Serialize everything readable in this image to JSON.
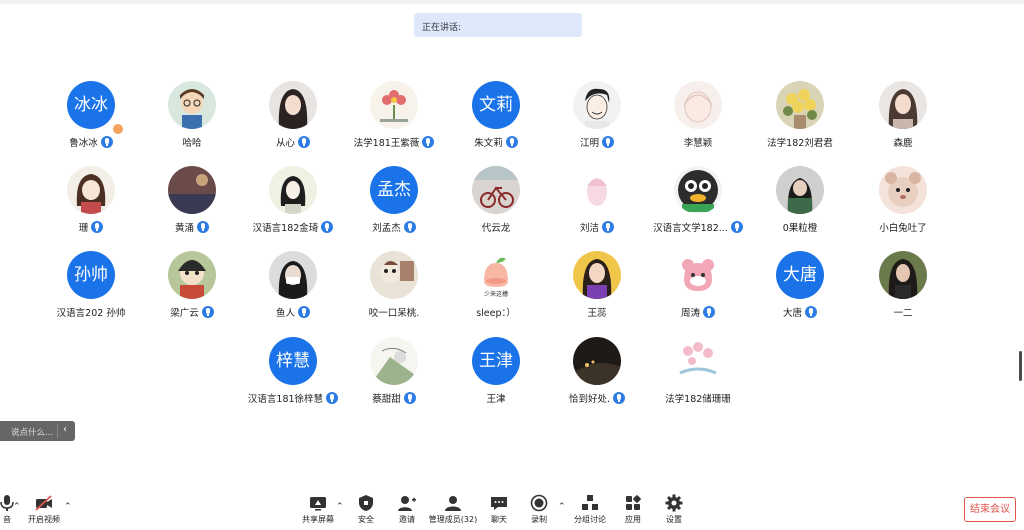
{
  "speaking_banner": "正在讲话:",
  "participants": [
    {
      "name": "鲁冰冰",
      "avatar_text": "冰冰",
      "mic": true,
      "host": true
    },
    {
      "name": "哈哈",
      "avatar_text": "",
      "mic": false
    },
    {
      "name": "从心",
      "avatar_text": "",
      "mic": true
    },
    {
      "name": "法学181王紫薇",
      "avatar_text": "",
      "mic": true
    },
    {
      "name": "朱文莉",
      "avatar_text": "文莉",
      "mic": true
    },
    {
      "name": "江明",
      "avatar_text": "",
      "mic": true
    },
    {
      "name": "李慧颖",
      "avatar_text": "",
      "mic": false
    },
    {
      "name": "法学182刘君君",
      "avatar_text": "",
      "mic": false
    },
    {
      "name": "森鹿",
      "avatar_text": "",
      "mic": false
    },
    {
      "name": "珊",
      "avatar_text": "",
      "mic": true
    },
    {
      "name": "黄涌",
      "avatar_text": "",
      "mic": true
    },
    {
      "name": "汉语言182金琦",
      "avatar_text": "",
      "mic": true
    },
    {
      "name": "刘孟杰",
      "avatar_text": "孟杰",
      "mic": true
    },
    {
      "name": "代云龙",
      "avatar_text": "",
      "mic": false
    },
    {
      "name": "刘洁",
      "avatar_text": "",
      "mic": true
    },
    {
      "name": "汉语言文学182...",
      "avatar_text": "",
      "mic": true
    },
    {
      "name": "0果粒橙",
      "avatar_text": "",
      "mic": false
    },
    {
      "name": "小白兔吐了",
      "avatar_text": "",
      "mic": false
    },
    {
      "name": "汉语言202 孙帅",
      "avatar_text": "孙帅",
      "mic": false
    },
    {
      "name": "梁广云",
      "avatar_text": "",
      "mic": true
    },
    {
      "name": "鱼人",
      "avatar_text": "",
      "mic": true
    },
    {
      "name": "咬一口呆桃.",
      "avatar_text": "",
      "mic": false
    },
    {
      "name": "sleep：）",
      "avatar_text": "",
      "mic": false
    },
    {
      "name": "王蕊",
      "avatar_text": "",
      "mic": false
    },
    {
      "name": "周涛",
      "avatar_text": "",
      "mic": true
    },
    {
      "name": "大唐",
      "avatar_text": "大唐",
      "mic": true
    },
    {
      "name": "一二",
      "avatar_text": "",
      "mic": false
    },
    {
      "name": "汉语言181徐梓慧",
      "avatar_text": "梓慧",
      "mic": true
    },
    {
      "name": "蔡甜甜",
      "avatar_text": "",
      "mic": true
    },
    {
      "name": "王津",
      "avatar_text": "王津",
      "mic": false
    },
    {
      "name": "恰到好处.",
      "avatar_text": "",
      "mic": true
    },
    {
      "name": "法学182储珊珊",
      "avatar_text": "",
      "mic": false
    }
  ],
  "avatar_image_texts": {
    "sleep_sticker": "少来这槽"
  },
  "chat_input": {
    "placeholder": "说点什么...",
    "collapse_icon": "chevron-left-icon"
  },
  "toolbar": {
    "audio_label": "音",
    "video_label": "开启视频",
    "share_label": "共享屏幕",
    "security_label": "安全",
    "invite_label": "邀请",
    "members_label": "管理成员(32)",
    "chat_label": "聊天",
    "record_label": "录制",
    "breakout_label": "分组讨论",
    "apps_label": "应用",
    "settings_label": "设置",
    "end_label": "结束会议"
  },
  "colors": {
    "accent": "#1a73e8",
    "banner_bg": "#dde9fb",
    "end_red": "#e0554a"
  }
}
